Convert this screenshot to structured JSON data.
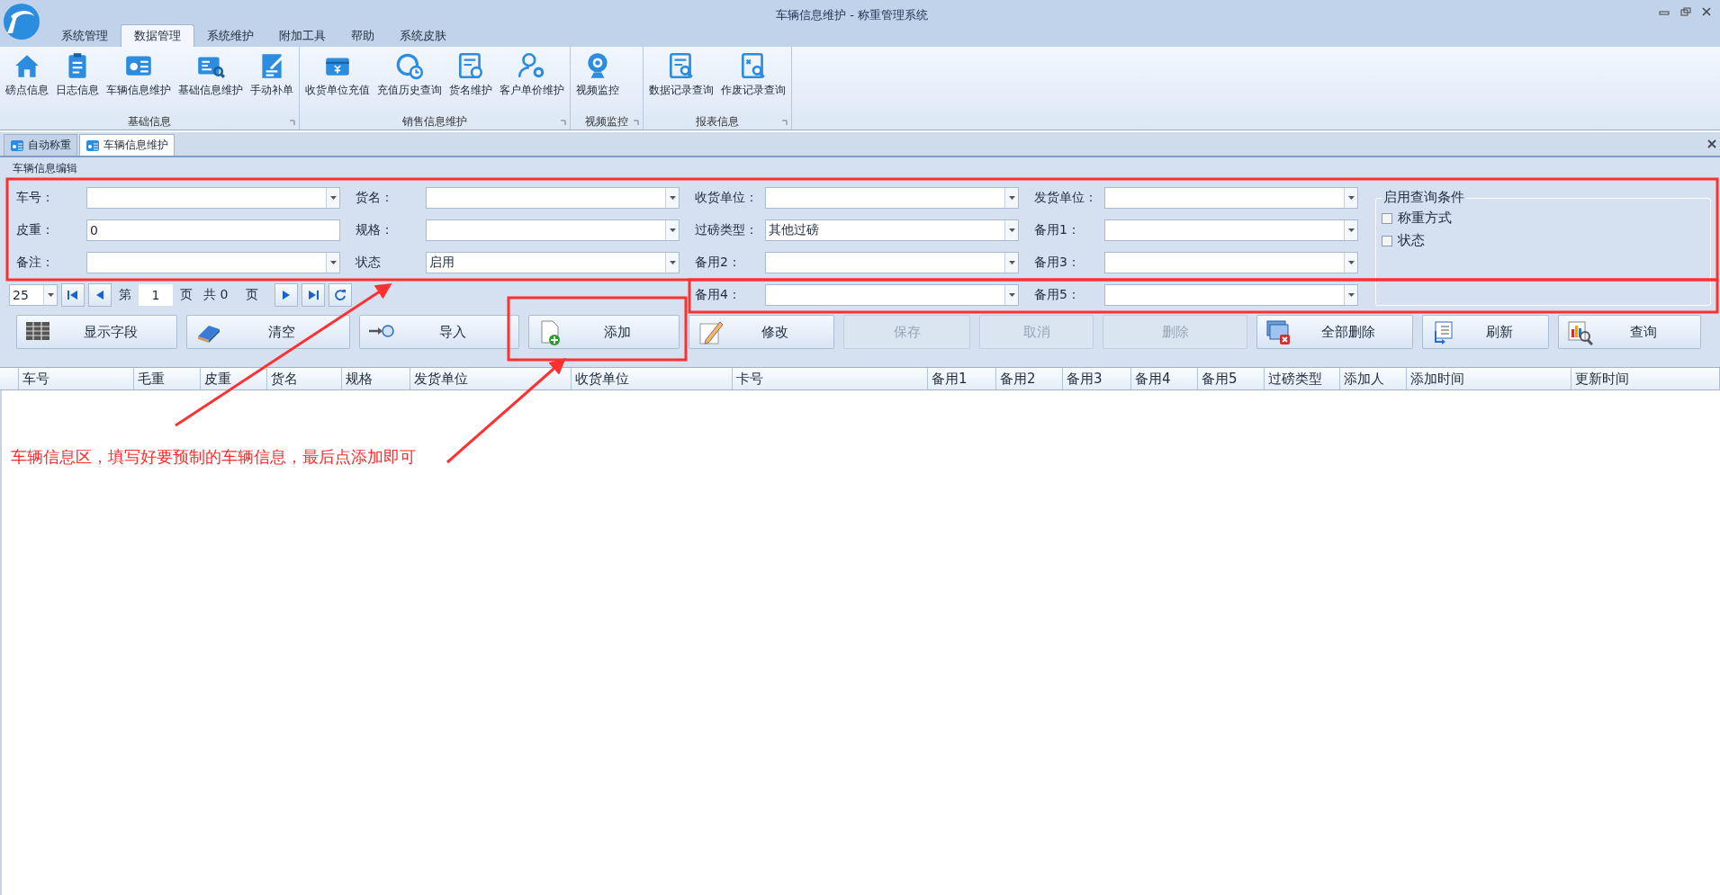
{
  "window": {
    "title": "车辆信息维护 - 称重管理系统"
  },
  "menu_tabs": [
    {
      "label": "系统管理",
      "selected": false
    },
    {
      "label": "数据管理",
      "selected": true
    },
    {
      "label": "系统维护",
      "selected": false
    },
    {
      "label": "附加工具",
      "selected": false
    },
    {
      "label": "帮助",
      "selected": false
    },
    {
      "label": "系统皮肤",
      "selected": false
    }
  ],
  "ribbon": {
    "groups": [
      {
        "label": "基础信息",
        "items": [
          "磅点信息",
          "日志信息",
          "车辆信息维护",
          "基础信息维护",
          "手动补单"
        ]
      },
      {
        "label": "销售信息维护",
        "items": [
          "收货单位充值",
          "充值历史查询",
          "货名维护",
          "客户单价维护"
        ]
      },
      {
        "label": "视频监控",
        "items": [
          "视频监控"
        ]
      },
      {
        "label": "报表信息",
        "items": [
          "数据记录查询",
          "作废记录查询"
        ]
      }
    ]
  },
  "doc_tabs": [
    {
      "label": "自动称重",
      "selected": false
    },
    {
      "label": "车辆信息维护",
      "selected": true
    }
  ],
  "panel_title": "车辆信息编辑",
  "form": {
    "rows": [
      [
        {
          "label": "车号：",
          "kind": "combo"
        },
        {
          "label": "货名：",
          "kind": "combo"
        },
        {
          "label": "收货单位：",
          "kind": "combo"
        },
        {
          "label": "发货单位：",
          "kind": "combo"
        }
      ],
      [
        {
          "label": "皮重：",
          "kind": "text",
          "value": "0"
        },
        {
          "label": "规格：",
          "kind": "combo"
        },
        {
          "label": "过磅类型：",
          "kind": "combo",
          "value": "其他过磅"
        },
        {
          "label": "备用1：",
          "kind": "combo"
        }
      ],
      [
        {
          "label": "备注：",
          "kind": "combo"
        },
        {
          "label": "状态",
          "kind": "combo",
          "value": "启用"
        },
        {
          "label": "备用2：",
          "kind": "combo"
        },
        {
          "label": "备用3：",
          "kind": "combo"
        }
      ]
    ],
    "pager_row_fields": [
      {
        "label": "备用4：",
        "kind": "combo"
      },
      {
        "label": "备用5：",
        "kind": "combo"
      }
    ]
  },
  "query_conditions": {
    "title": "启用查询条件",
    "options": [
      {
        "label": "称重方式",
        "checked": false
      },
      {
        "label": "状态",
        "checked": false
      }
    ]
  },
  "pager": {
    "page_size": "25",
    "page_prefix": "第",
    "page": "1",
    "page_suffix": "页",
    "total": "共 0",
    "total_suffix": "页"
  },
  "actions": [
    {
      "label": "显示字段",
      "disabled": false
    },
    {
      "label": "清空",
      "disabled": false
    },
    {
      "label": "导入",
      "disabled": false
    },
    {
      "label": "添加",
      "disabled": false
    },
    {
      "label": "修改",
      "disabled": false
    },
    {
      "label": "保存",
      "disabled": true
    },
    {
      "label": "取消",
      "disabled": true
    },
    {
      "label": "删除",
      "disabled": true
    },
    {
      "label": "全部删除",
      "disabled": false
    },
    {
      "label": "刷新",
      "disabled": false
    },
    {
      "label": "查询",
      "disabled": false
    }
  ],
  "table": {
    "columns": [
      "车号",
      "毛重",
      "皮重",
      "货名",
      "规格",
      "发货单位",
      "收货单位",
      "卡号",
      "备用1",
      "备用2",
      "备用3",
      "备用4",
      "备用5",
      "过磅类型",
      "添加人",
      "添加时间",
      "更新时间"
    ]
  },
  "annotation": {
    "caption": "车辆信息区，填写好要预制的车辆信息，最后点添加即可"
  }
}
